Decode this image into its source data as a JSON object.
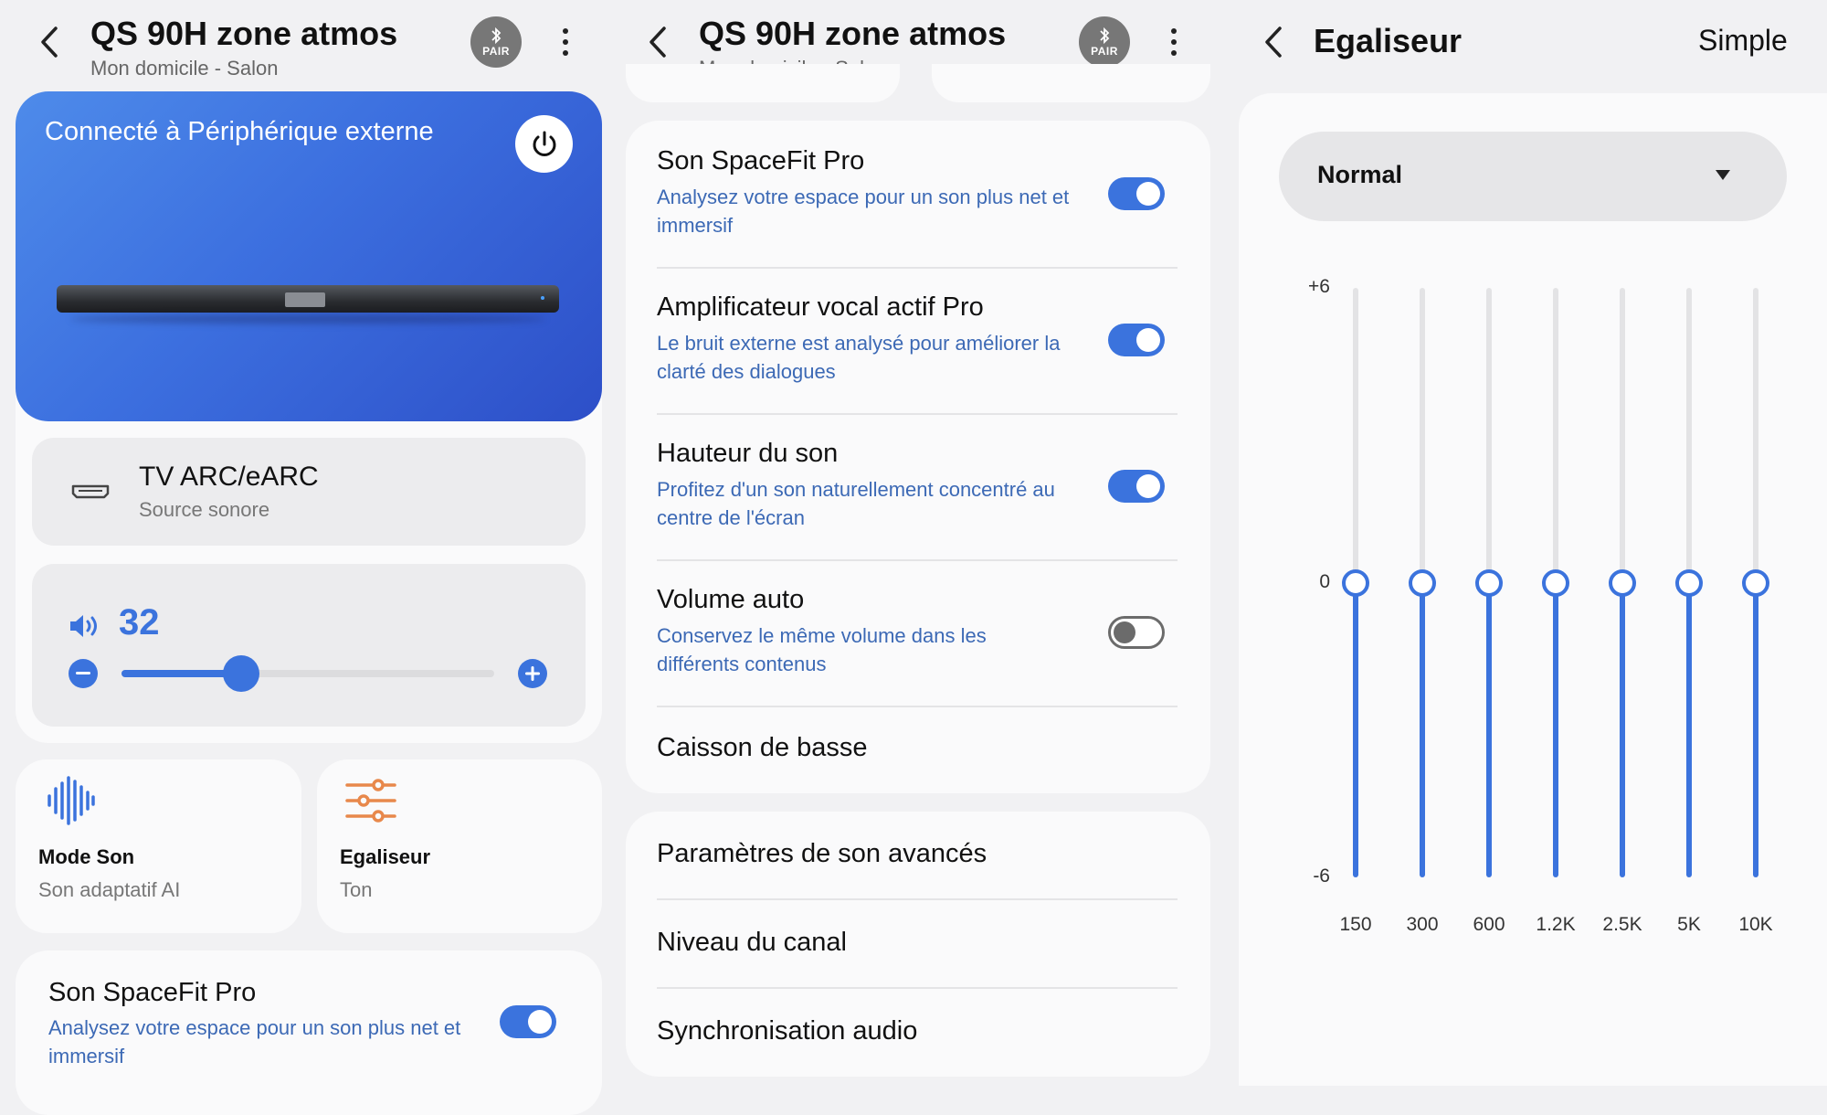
{
  "panel1": {
    "title": "QS 90H zone atmos",
    "subtitle": "Mon domicile - Salon",
    "pair_label": "PAIR",
    "hero": {
      "status": "Connecté à Périphérique externe"
    },
    "source": {
      "title": "TV ARC/eARC",
      "subtitle": "Source sonore"
    },
    "volume": {
      "value": "32",
      "level": 32,
      "max": 100
    },
    "tiles": [
      {
        "title": "Mode Son",
        "subtitle": "Son adaptatif AI",
        "icon": "waveform-icon"
      },
      {
        "title": "Egaliseur",
        "subtitle": "Ton",
        "icon": "equalizer-sliders-icon"
      }
    ],
    "spacefit": {
      "title": "Son SpaceFit Pro",
      "desc": "Analysez votre espace pour un son plus net et immersif",
      "on": true
    }
  },
  "panel2": {
    "title": "QS 90H zone atmos",
    "subtitle": "Mon domicile - Salon",
    "pair_label": "PAIR",
    "settings": [
      {
        "title": "Son SpaceFit Pro",
        "desc": "Analysez votre espace pour un son plus net et immersif",
        "on": true
      },
      {
        "title": "Amplificateur vocal actif Pro",
        "desc": "Le bruit externe est analysé pour améliorer la clarté des dialogues",
        "on": true
      },
      {
        "title": "Hauteur du son",
        "desc": "Profitez d'un son naturellement concentré au centre de l'écran",
        "on": true
      },
      {
        "title": "Volume auto",
        "desc": "Conservez le même volume dans les différents contenus",
        "on": false
      },
      {
        "title": "Caisson de basse"
      }
    ],
    "advanced": [
      {
        "title": "Paramètres de son avancés"
      },
      {
        "title": "Niveau du canal"
      },
      {
        "title": "Synchronisation audio"
      }
    ]
  },
  "panel3": {
    "title": "Egaliseur",
    "mode_button": "Simple",
    "preset": "Normal",
    "db_labels": {
      "max": "+6",
      "zero": "0",
      "min": "-6"
    },
    "bands": [
      {
        "freq": "150",
        "gain": 0
      },
      {
        "freq": "300",
        "gain": 0
      },
      {
        "freq": "600",
        "gain": 0
      },
      {
        "freq": "1.2K",
        "gain": 0
      },
      {
        "freq": "2.5K",
        "gain": 0
      },
      {
        "freq": "5K",
        "gain": 0
      },
      {
        "freq": "10K",
        "gain": 0
      }
    ]
  },
  "colors": {
    "accent": "#3b73dd",
    "desc_text": "#3c69b5",
    "equalizer_icon": "#e8884b"
  }
}
